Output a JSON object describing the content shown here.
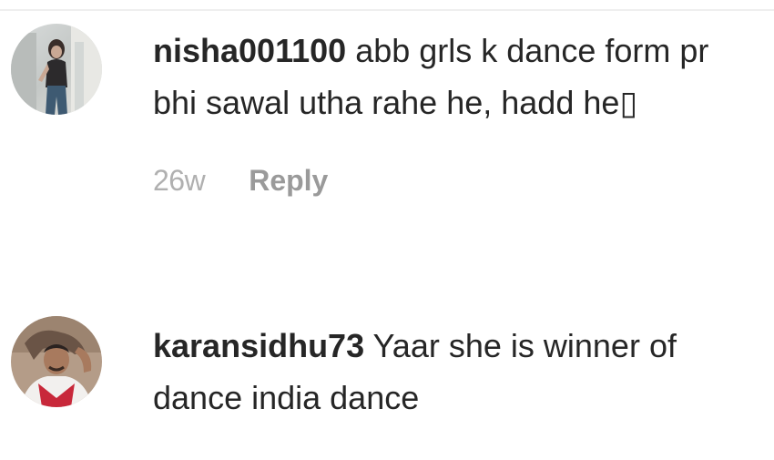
{
  "comments": [
    {
      "username": "nisha001100",
      "text": "abb grls k dance form pr bhi sawal utha rahe he, hadd he▯",
      "timestamp": "26w",
      "reply_label": "Reply"
    },
    {
      "username": "karansidhu73",
      "text": "Yaar she is winner of dance india dance"
    }
  ]
}
